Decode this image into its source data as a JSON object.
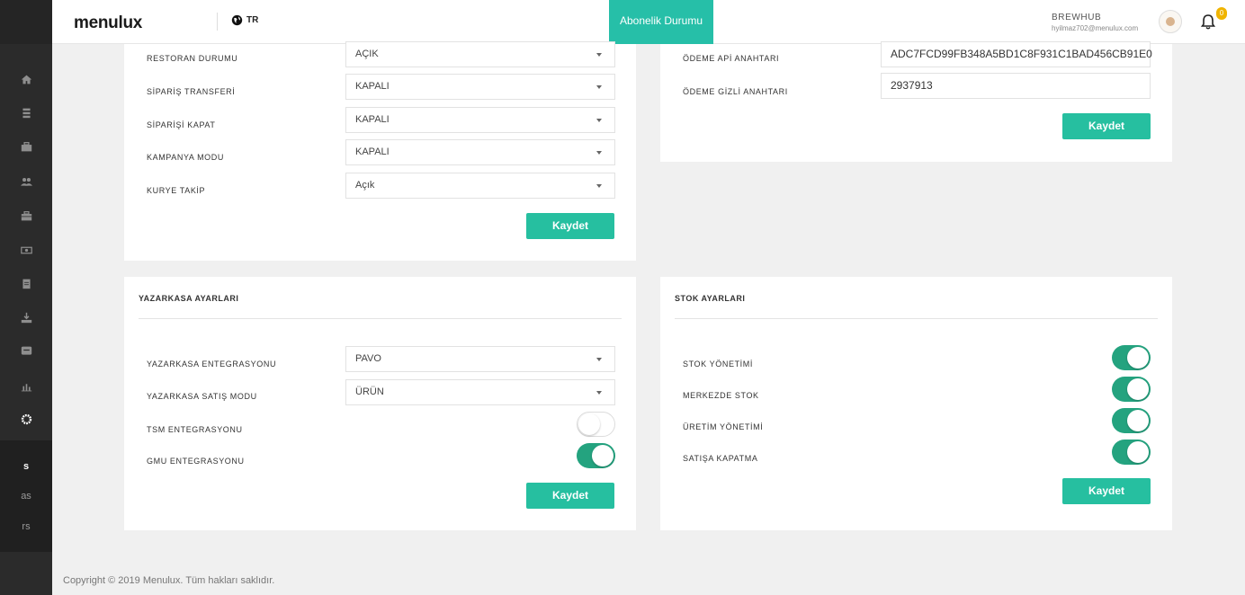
{
  "app": {
    "logo": "menulux",
    "language": "TR"
  },
  "header": {
    "subscription_button": "Abonelik Durumu",
    "user_name": "BREWHUB",
    "user_email": "hyilmaz702@menulux.com",
    "notification_count": "0"
  },
  "sidebar": {
    "icons": [
      "home-icon",
      "menu-icon",
      "briefcase-icon",
      "users-icon",
      "toolbox-icon",
      "money-icon",
      "clipboard-icon",
      "download-icon",
      "message-icon",
      "chart-icon",
      "settings-icon"
    ],
    "bottom_items": [
      "s",
      "as",
      "rs"
    ]
  },
  "restaurant_panel": {
    "rows": [
      {
        "label": "RESTORAN DURUMU",
        "value": "AÇIK"
      },
      {
        "label": "SİPARİŞ TRANSFERİ",
        "value": "KAPALI"
      },
      {
        "label": "SİPARİŞİ KAPAT",
        "value": "KAPALI"
      },
      {
        "label": "KAMPANYA MODU",
        "value": "KAPALI"
      },
      {
        "label": "KURYE TAKİP",
        "value": "Açık"
      }
    ],
    "save_label": "Kaydet"
  },
  "payment_panel": {
    "api_key_label": "ÖDEME APİ ANAHTARI",
    "api_key_value": "ADC7FCD99FB348A5BD1C8F931C1BAD456CB91E0",
    "secret_key_label": "ÖDEME GİZLİ ANAHTARI",
    "secret_key_value": "2937913",
    "save_label": "Kaydet"
  },
  "cash_register_panel": {
    "title": "YAZARKASA AYARLARI",
    "integration_label": "YAZARKASA ENTEGRASYONU",
    "integration_value": "PAVO",
    "sales_mode_label": "YAZARKASA SATIŞ MODU",
    "sales_mode_value": "ÜRÜN",
    "tsm_label": "TSM ENTEGRASYONU",
    "tsm_on": false,
    "gmu_label": "GMU ENTEGRASYONU",
    "gmu_on": true,
    "save_label": "Kaydet"
  },
  "stock_panel": {
    "title": "STOK AYARLARI",
    "rows": [
      {
        "label": "STOK YÖNETİMİ",
        "on": true
      },
      {
        "label": "MERKEZDE STOK",
        "on": true
      },
      {
        "label": "ÜRETİM YÖNETİMİ",
        "on": true
      },
      {
        "label": "SATIŞA KAPATMA",
        "on": true
      }
    ],
    "save_label": "Kaydet"
  },
  "footer": {
    "text": "Copyright © 2019 Menulux. Tüm hakları saklıdır."
  },
  "colors": {
    "accent": "#26bfa8",
    "toggle_on": "#24a37f",
    "sidebar": "#2b2b2b"
  }
}
